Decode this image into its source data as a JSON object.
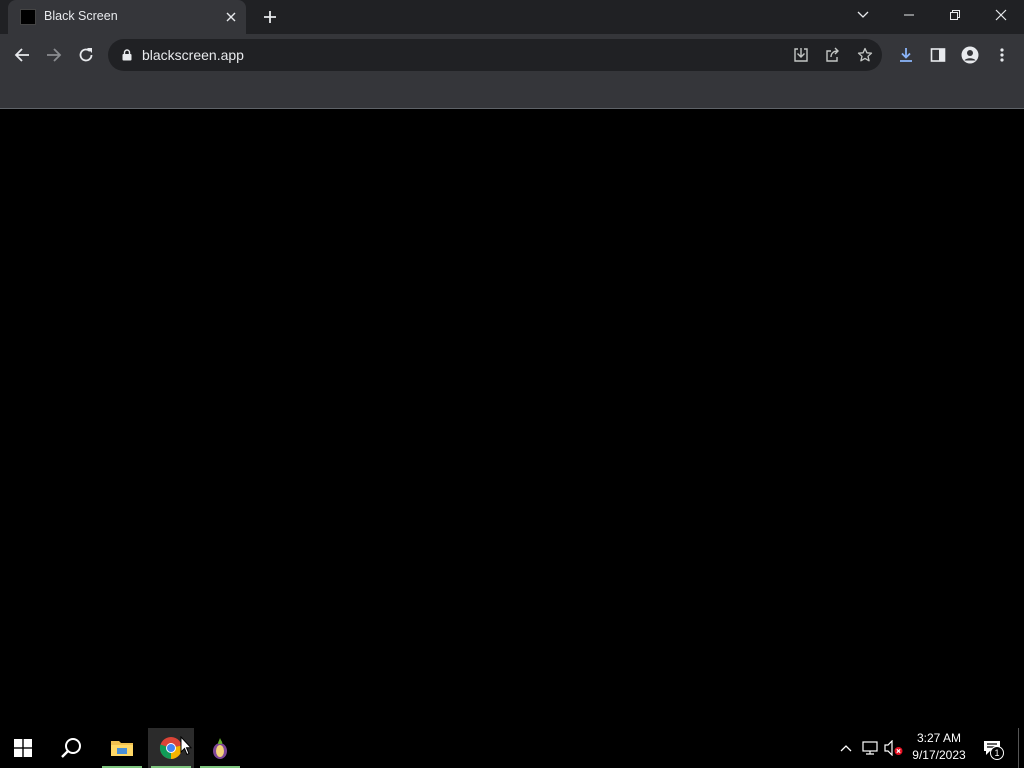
{
  "tab": {
    "title": "Black Screen",
    "favicon": "black-square-icon"
  },
  "address_bar": {
    "url": "blackscreen.app"
  },
  "toolbar": {
    "icons": [
      "back-icon",
      "forward-icon",
      "reload-icon",
      "lock-icon",
      "install-app-icon",
      "share-icon",
      "bookmark-star-icon",
      "downloads-icon",
      "side-panel-icon",
      "profile-icon",
      "menu-icon"
    ]
  },
  "taskbar": {
    "apps": [
      "start-icon",
      "search-icon",
      "file-explorer-icon",
      "chrome-icon",
      "tor-browser-icon"
    ],
    "active_app": "chrome"
  },
  "clock": {
    "time": "3:27 AM",
    "date": "9/17/2023"
  },
  "notifications": {
    "count": "1"
  },
  "colors": {
    "page_background": "#000000",
    "tab_strip": "#202124",
    "toolbar": "#35363a",
    "omnibox": "#202124",
    "taskbar_underline": "#7ec57e"
  }
}
